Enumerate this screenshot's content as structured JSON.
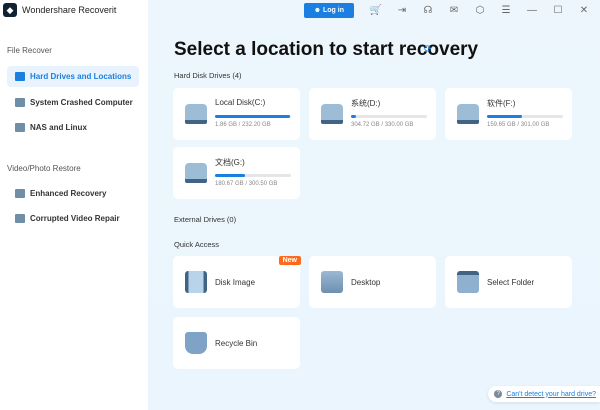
{
  "app": {
    "title": "Wondershare Recoverit"
  },
  "sidebar": {
    "section_file": "File Recover",
    "items": [
      {
        "label": "Hard Drives and Locations"
      },
      {
        "label": "System Crashed Computer"
      },
      {
        "label": "NAS and Linux"
      }
    ],
    "section_video": "Video/Photo Restore",
    "video_items": [
      {
        "label": "Enhanced Recovery"
      },
      {
        "label": "Corrupted Video Repair"
      }
    ]
  },
  "topbar": {
    "login_label": "Log in"
  },
  "main": {
    "title": "Select a location to start recovery",
    "hard_disk_label": "Hard Disk Drives (4)",
    "drives": [
      {
        "name": "Local Disk(C:)",
        "size": "1.86 GB / 232.20 GB",
        "fill": 0.99
      },
      {
        "name": "系统(D:)",
        "size": "304.72 GB / 330.00 GB",
        "fill": 0.06
      },
      {
        "name": "软件(F:)",
        "size": "159.65 GB / 301.00 GB",
        "fill": 0.46
      },
      {
        "name": "文档(G:)",
        "size": "180.67 GB / 300.50 GB",
        "fill": 0.39
      }
    ],
    "external_label": "External Drives (0)",
    "quick_label": "Quick Access",
    "quick": [
      {
        "name": "Disk Image",
        "badge": "New"
      },
      {
        "name": "Desktop"
      },
      {
        "name": "Select Folder"
      },
      {
        "name": "Recycle Bin"
      }
    ],
    "help_link": "Can't detect your hard drive?"
  },
  "colors": {
    "accent": "#1a7fe0",
    "badge": "#ff6a1a"
  }
}
